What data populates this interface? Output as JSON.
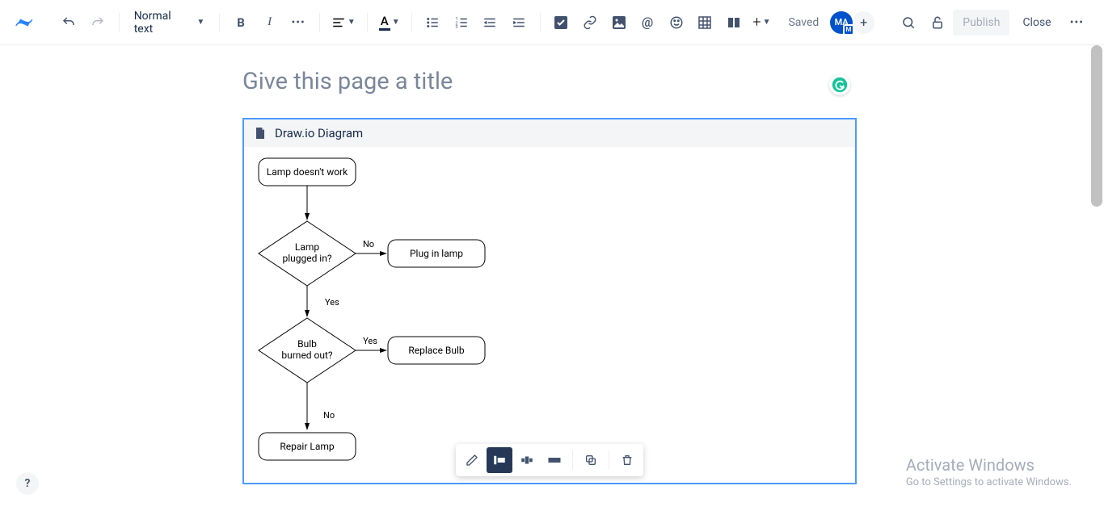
{
  "toolbar": {
    "text_style": "Normal text",
    "saved": "Saved",
    "avatar": "MA",
    "avatar_badge": "M",
    "publish": "Publish",
    "close": "Close"
  },
  "editor": {
    "title_placeholder": "Give this page a title"
  },
  "macro": {
    "title": "Draw.io Diagram"
  },
  "flowchart": {
    "nodes": {
      "start": "Lamp doesn't work",
      "d1_l1": "Lamp",
      "d1_l2": "plugged in?",
      "a1": "Plug in lamp",
      "d2_l1": "Bulb",
      "d2_l2": "burned out?",
      "a2": "Replace Bulb",
      "end": "Repair Lamp"
    },
    "edges": {
      "no1": "No",
      "yes1": "Yes",
      "yes2": "Yes",
      "no2": "No"
    }
  },
  "watermark": {
    "title": "Activate Windows",
    "sub": "Go to Settings to activate Windows."
  }
}
